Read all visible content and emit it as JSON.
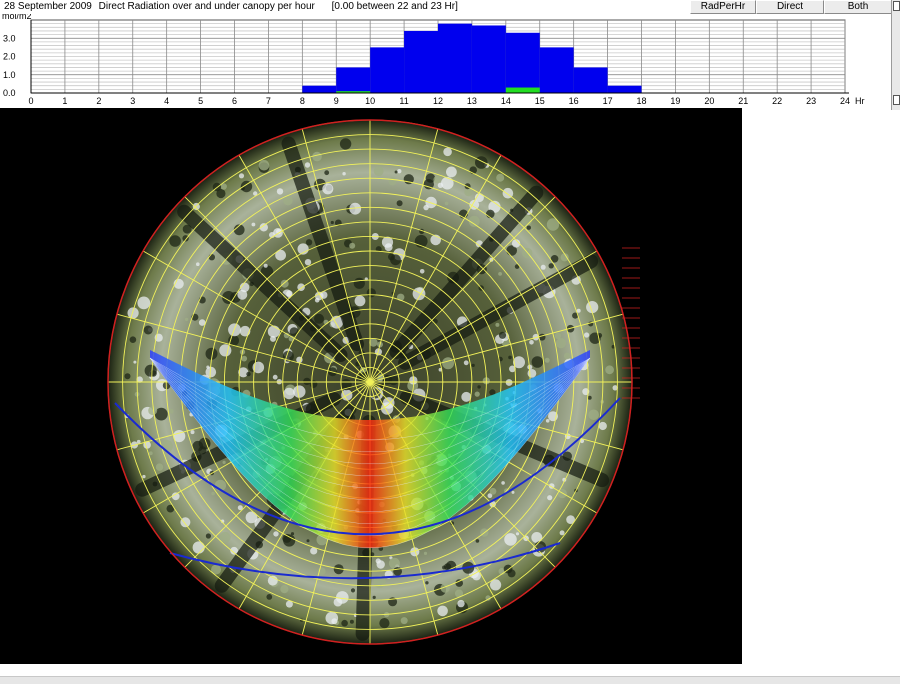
{
  "header": {
    "date": "28 September 2009",
    "title": "Direct Radiation over and under canopy per hour",
    "range_note": "[0.00 between 22 and 23 Hr]"
  },
  "buttons": {
    "rad_per_hr": "RadPerHr",
    "direct": "Direct",
    "both": "Both"
  },
  "chart_data": {
    "type": "bar",
    "ylabel": "mol/m2",
    "xlabel": "Hr",
    "ylim": [
      0,
      4
    ],
    "xlim": [
      0,
      24
    ],
    "y_ticks": [
      "0.0",
      "1.0",
      "2.0",
      "3.0"
    ],
    "x_ticks": [
      "0",
      "1",
      "2",
      "3",
      "4",
      "5",
      "6",
      "7",
      "8",
      "9",
      "10",
      "11",
      "12",
      "13",
      "14",
      "15",
      "16",
      "17",
      "18",
      "19",
      "20",
      "21",
      "22",
      "23",
      "24"
    ],
    "grid": true,
    "series": [
      {
        "color": "#0000ee",
        "bars": [
          {
            "hour": 8,
            "value": 0.4
          },
          {
            "hour": 9,
            "value": 1.4
          },
          {
            "hour": 10,
            "value": 2.5
          },
          {
            "hour": 11,
            "value": 3.4
          },
          {
            "hour": 12,
            "value": 3.8
          },
          {
            "hour": 13,
            "value": 3.7
          },
          {
            "hour": 14,
            "value": 3.3
          },
          {
            "hour": 15,
            "value": 2.5
          },
          {
            "hour": 16,
            "value": 1.4
          },
          {
            "hour": 17,
            "value": 0.4
          }
        ]
      },
      {
        "color": "#22dd22",
        "bars": [
          {
            "hour": 9,
            "value": 0.1
          },
          {
            "hour": 14,
            "value": 0.3
          }
        ]
      }
    ]
  },
  "colors": {
    "grid_yellow": "#f2f25a",
    "horizon_red": "#d02020",
    "horizon_blue": "#1a2ad0"
  }
}
